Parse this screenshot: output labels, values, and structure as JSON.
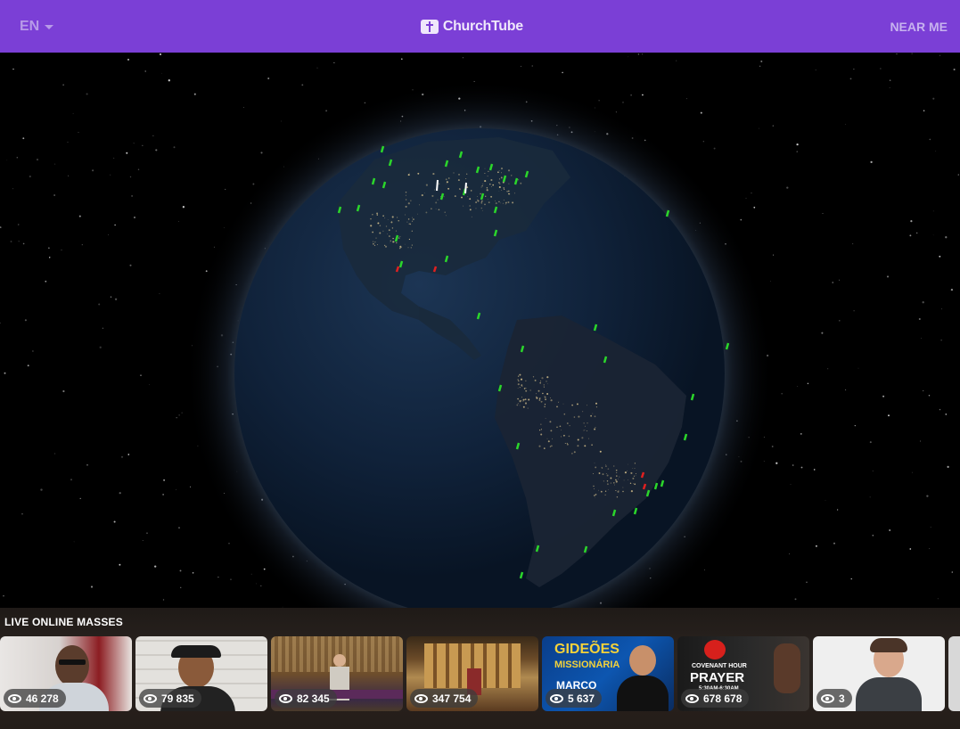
{
  "header": {
    "language": "EN",
    "brand": "ChurchTube",
    "near_me": "NEAR ME"
  },
  "strip": {
    "title": "LIVE ONLINE MASSES",
    "cards": [
      {
        "views": "46 278"
      },
      {
        "views": "79 835"
      },
      {
        "views": "82 345"
      },
      {
        "views": "347 754"
      },
      {
        "views": "5 637",
        "line1": "GIDEÕES",
        "line2": "MISSIONÁRIA",
        "line3": "MARCO"
      },
      {
        "views": "678 678",
        "line1": "COVENANT HOUR",
        "line2": "PRAYER",
        "line3": "5:30AM-6:30AM"
      },
      {
        "views": "3"
      }
    ]
  },
  "colors": {
    "header_bg": "#7b3fd6",
    "marker_live": "#2bd62b",
    "marker_alert": "#e02020"
  }
}
